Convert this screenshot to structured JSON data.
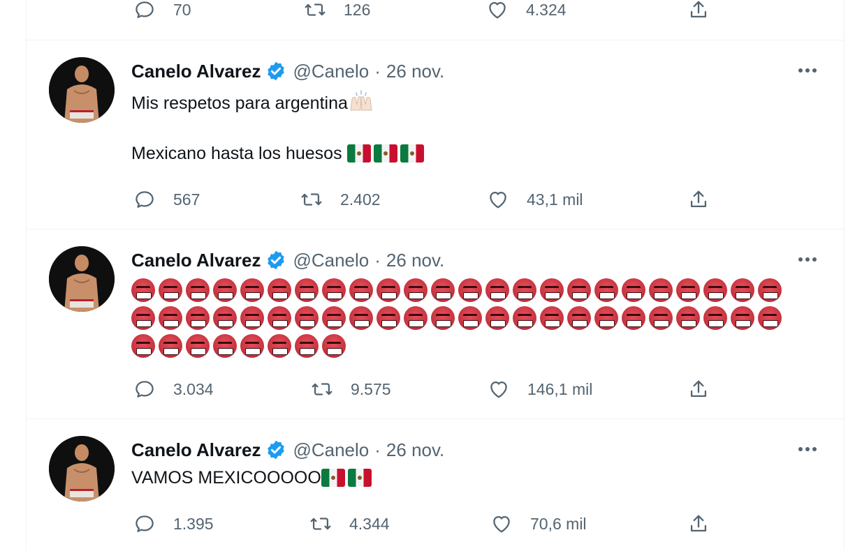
{
  "top_actions": {
    "reply": "70",
    "retweet": "126",
    "like": "4.324"
  },
  "tweets": [
    {
      "name": "Canelo Alvarez",
      "handle": "@Canelo",
      "dot": "·",
      "date": "26 nov.",
      "line1": "Mis respetos para argentina",
      "line2": "Mexicano hasta los huesos ",
      "reply": "567",
      "retweet": "2.402",
      "like": "43,1 mil"
    },
    {
      "name": "Canelo Alvarez",
      "handle": "@Canelo",
      "dot": "·",
      "date": "26 nov.",
      "angry_emoji_rows": [
        24,
        24,
        8
      ],
      "reply": "3.034",
      "retweet": "9.575",
      "like": "146,1 mil"
    },
    {
      "name": "Canelo Alvarez",
      "handle": "@Canelo",
      "dot": "·",
      "date": "26 nov.",
      "line1": "VAMOS MEXICOOOOO",
      "reply": "1.395",
      "retweet": "4.344",
      "like": "70,6 mil"
    }
  ],
  "icons": {
    "reply": "reply-icon",
    "retweet": "retweet-icon",
    "like": "heart-icon",
    "share": "share-icon",
    "verified": "verified-badge-icon",
    "more": "more-icon"
  },
  "colors": {
    "verified": "#1d9bf0",
    "muted": "#536471",
    "text": "#0f1419"
  }
}
